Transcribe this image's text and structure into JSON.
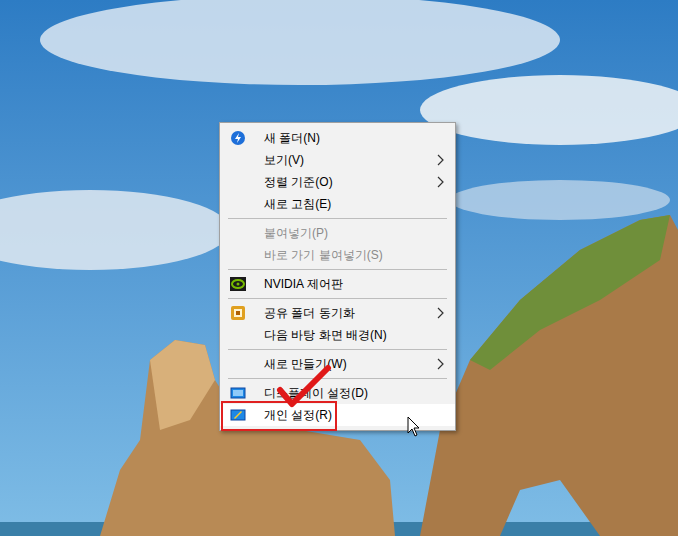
{
  "desktop": {
    "wallpaper": "photo"
  },
  "context_menu": {
    "items": [
      {
        "kind": "item",
        "label": "새 폴더(N)",
        "disabled": false,
        "submenu": false,
        "selected": false
      },
      {
        "kind": "item",
        "label": "보기(V)",
        "disabled": false,
        "submenu": true,
        "selected": false
      },
      {
        "kind": "item",
        "label": "정렬 기준(O)",
        "disabled": false,
        "submenu": true,
        "selected": false
      },
      {
        "kind": "item",
        "label": "새로 고침(E)",
        "disabled": false,
        "submenu": false,
        "selected": false
      },
      {
        "kind": "separator"
      },
      {
        "kind": "item",
        "label": "붙여넣기(P)",
        "disabled": true,
        "submenu": false,
        "selected": false
      },
      {
        "kind": "item",
        "label": "바로 가기 붙여넣기(S)",
        "disabled": true,
        "submenu": false,
        "selected": false
      },
      {
        "kind": "separator"
      },
      {
        "kind": "item",
        "label": "NVIDIA 제어판",
        "disabled": false,
        "submenu": false,
        "selected": false
      },
      {
        "kind": "separator"
      },
      {
        "kind": "item",
        "label": "공유 폴더 동기화",
        "disabled": false,
        "submenu": true,
        "selected": false
      },
      {
        "kind": "item",
        "label": "다음 바탕 화면 배경(N)",
        "disabled": false,
        "submenu": false,
        "selected": false
      },
      {
        "kind": "separator"
      },
      {
        "kind": "item",
        "label": "새로 만들기(W)",
        "disabled": false,
        "submenu": true,
        "selected": false
      },
      {
        "kind": "separator"
      },
      {
        "kind": "item",
        "label": "디스플레이 설정(D)",
        "disabled": false,
        "submenu": false,
        "selected": false
      },
      {
        "kind": "item",
        "label": "개인 설정(R)",
        "disabled": false,
        "submenu": false,
        "selected": true
      }
    ]
  },
  "annotations": {
    "highlight_box": true,
    "check_mark": true
  }
}
